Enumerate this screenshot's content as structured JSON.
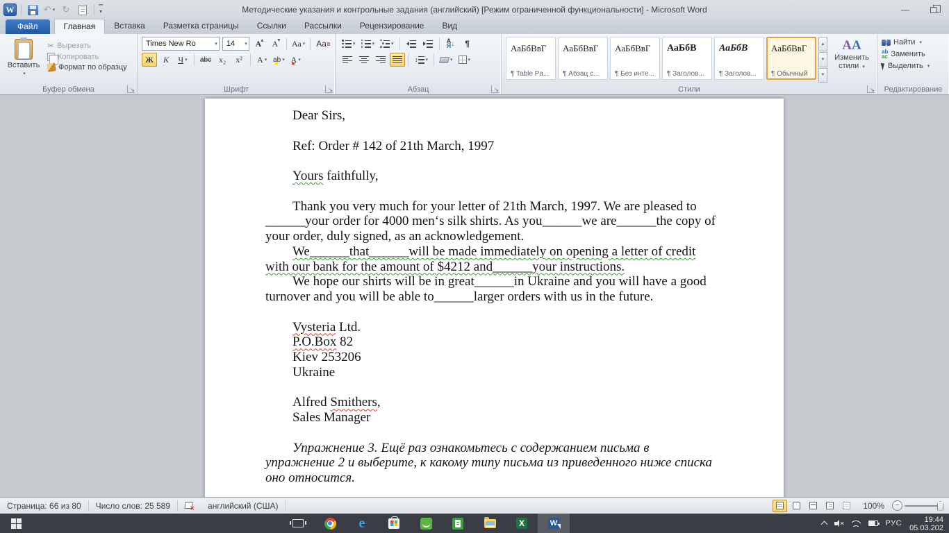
{
  "window": {
    "title": "Методические указания и контрольные задания (английский) [Режим ограниченной функциональности] - Microsoft Word",
    "minimize_glyph": "—"
  },
  "colors": {
    "accent_highlight": "#fbd66b",
    "file_tab_blue": "#2d63ad",
    "taskbar_dark": "#3a3d44",
    "word_blue": "#2b579a"
  },
  "tabs": {
    "file": "Файл",
    "items": [
      {
        "key": "home",
        "label": "Главная",
        "active": true
      },
      {
        "key": "insert",
        "label": "Вставка",
        "active": false
      },
      {
        "key": "page-layout",
        "label": "Разметка страницы",
        "active": false
      },
      {
        "key": "references",
        "label": "Ссылки",
        "active": false
      },
      {
        "key": "mailings",
        "label": "Рассылки",
        "active": false
      },
      {
        "key": "review",
        "label": "Рецензирование",
        "active": false
      },
      {
        "key": "view",
        "label": "Вид",
        "active": false
      }
    ]
  },
  "ribbon": {
    "clipboard": {
      "label": "Буфер обмена",
      "paste": "Вставить",
      "cut": "Вырезать",
      "copy": "Копировать",
      "format_painter": "Формат по образцу"
    },
    "font": {
      "label": "Шрифт",
      "family": "Times New Ro",
      "size": "14",
      "bold": "Ж",
      "italic": "К",
      "underline": "Ч",
      "strike": "abc",
      "subscript": "x₂",
      "superscript": "x²",
      "grow": "А",
      "shrink": "А",
      "change_case": "Аа",
      "clear": "Aa",
      "highlight": "ab",
      "font_color": "А",
      "effects": "А"
    },
    "paragraph": {
      "label": "Абзац",
      "sort_a": "А",
      "sort_z": "Я",
      "sort_arrow": "↓",
      "pilcrow": "¶"
    },
    "styles": {
      "label": "Стили",
      "change": "Изменить стили",
      "items": [
        {
          "sample": "АаБбВвГ",
          "name": "¶ Table Pa...",
          "cls": ""
        },
        {
          "sample": "АаБбВвГ",
          "name": "¶ Абзац с...",
          "cls": ""
        },
        {
          "sample": "АаБбВвГ",
          "name": "¶ Без инте...",
          "cls": ""
        },
        {
          "sample": "АаБбВ",
          "name": "¶ Заголов...",
          "cls": "b"
        },
        {
          "sample": "АаБбВ",
          "name": "¶ Заголов...",
          "cls": "bi"
        },
        {
          "sample": "АаБбВвГ",
          "name": "¶ Обычный",
          "cls": "sel"
        }
      ]
    },
    "editing": {
      "label": "Редактирование",
      "find": "Найти",
      "replace": "Заменить",
      "select": "Выделить"
    }
  },
  "document": {
    "lines": [
      {
        "ind": 1,
        "seg": [
          [
            "Dear Sirs,"
          ]
        ]
      },
      {
        "seg": [
          [
            ""
          ]
        ]
      },
      {
        "ind": 1,
        "seg": [
          [
            "Ref: Order # 142 of 21th March, 1997"
          ]
        ]
      },
      {
        "seg": [
          [
            ""
          ]
        ]
      },
      {
        "ind": 1,
        "seg": [
          [
            "Yours",
            "g"
          ],
          [
            " faithfully,"
          ]
        ]
      },
      {
        "seg": [
          [
            ""
          ]
        ]
      },
      {
        "ind": 1,
        "seg": [
          [
            "Thank you very much for your letter of 21th March, 1997. We are pleased to"
          ]
        ]
      },
      {
        "seg": [
          [
            "______your order for 4000 men‘s silk shirts. As you______we are______the copy of"
          ]
        ]
      },
      {
        "seg": [
          [
            "your order, duly signed, as an acknowledgement."
          ]
        ]
      },
      {
        "ind": 1,
        "seg": [
          [
            "We______that______will be made immediately on opening a letter of credit",
            "g"
          ]
        ]
      },
      {
        "seg": [
          [
            "with our bank for the amount of $4212 and______your instructions.",
            "g"
          ]
        ]
      },
      {
        "ind": 1,
        "seg": [
          [
            "We hope our shirts will be in great______in Ukraine and you will have a good"
          ]
        ]
      },
      {
        "seg": [
          [
            "turnover and you will be able to______larger orders with us in the future."
          ]
        ]
      },
      {
        "seg": [
          [
            ""
          ]
        ]
      },
      {
        "ind": 1,
        "seg": [
          [
            "Vysteria",
            "r"
          ],
          [
            " Ltd."
          ]
        ]
      },
      {
        "ind": 1,
        "seg": [
          [
            "P.O.Box",
            "r"
          ],
          [
            " 82"
          ]
        ]
      },
      {
        "ind": 1,
        "seg": [
          [
            "Kiev 253206"
          ]
        ]
      },
      {
        "ind": 1,
        "seg": [
          [
            "Ukraine"
          ]
        ]
      },
      {
        "seg": [
          [
            ""
          ]
        ]
      },
      {
        "ind": 1,
        "seg": [
          [
            "Alfred "
          ],
          [
            "Smithers",
            "r"
          ],
          [
            ","
          ]
        ]
      },
      {
        "ind": 1,
        "seg": [
          [
            "Sales Manager"
          ]
        ]
      },
      {
        "seg": [
          [
            ""
          ]
        ]
      },
      {
        "ind": 1,
        "it": 1,
        "seg": [
          [
            "Упражнение 3. Ещё раз ознакомьтесь с содержанием письма в"
          ]
        ]
      },
      {
        "it": 1,
        "seg": [
          [
            "упражнение 2 и выберите, к какому типу письма из приведенного ниже списка"
          ]
        ]
      },
      {
        "it": 1,
        "seg": [
          [
            "оно относится."
          ]
        ]
      }
    ]
  },
  "status": {
    "page": "Страница: 66 из 80",
    "words": "Число слов: 25 589",
    "language": "английский (США)",
    "zoom": "100%"
  },
  "taskbar": {
    "icons": [
      "start",
      "task-view",
      "chrome",
      "edge",
      "store",
      "download-manager",
      "notes-app",
      "file-explorer",
      "excel",
      "word"
    ],
    "active_app": "word",
    "lang": "РУС",
    "time": "19:44",
    "date": "05.03.202"
  }
}
